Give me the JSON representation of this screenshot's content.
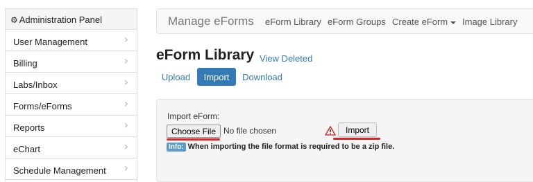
{
  "sidebar": {
    "header": "Administration Panel",
    "items": [
      {
        "label": "User Management"
      },
      {
        "label": "Billing"
      },
      {
        "label": "Labs/Inbox"
      },
      {
        "label": "Forms/eForms"
      },
      {
        "label": "Reports"
      },
      {
        "label": "eChart"
      },
      {
        "label": "Schedule Management"
      }
    ],
    "chevron_icon": "chevron-right-icon",
    "header_icon": "gear-icon"
  },
  "navbar": {
    "brand": "Manage eForms",
    "links": [
      "eForm Library",
      "eForm Groups",
      "Create eForm",
      "Image Library"
    ]
  },
  "page": {
    "title": "eForm Library",
    "view_deleted": "View Deleted"
  },
  "tabs": {
    "upload": "Upload",
    "import": "Import",
    "download": "Download",
    "active": "Import"
  },
  "import_form": {
    "label": "Import eForm:",
    "choose_file": "Choose File",
    "file_status": "No file chosen",
    "import_button": "Import",
    "warning_icon": "warning-triangle-icon",
    "info_badge": "Info:",
    "info_text": "When importing the file format is required to be a zip file."
  },
  "colors": {
    "accent": "#337ab7",
    "annotation": "#e02020",
    "warning": "#d9342b"
  }
}
